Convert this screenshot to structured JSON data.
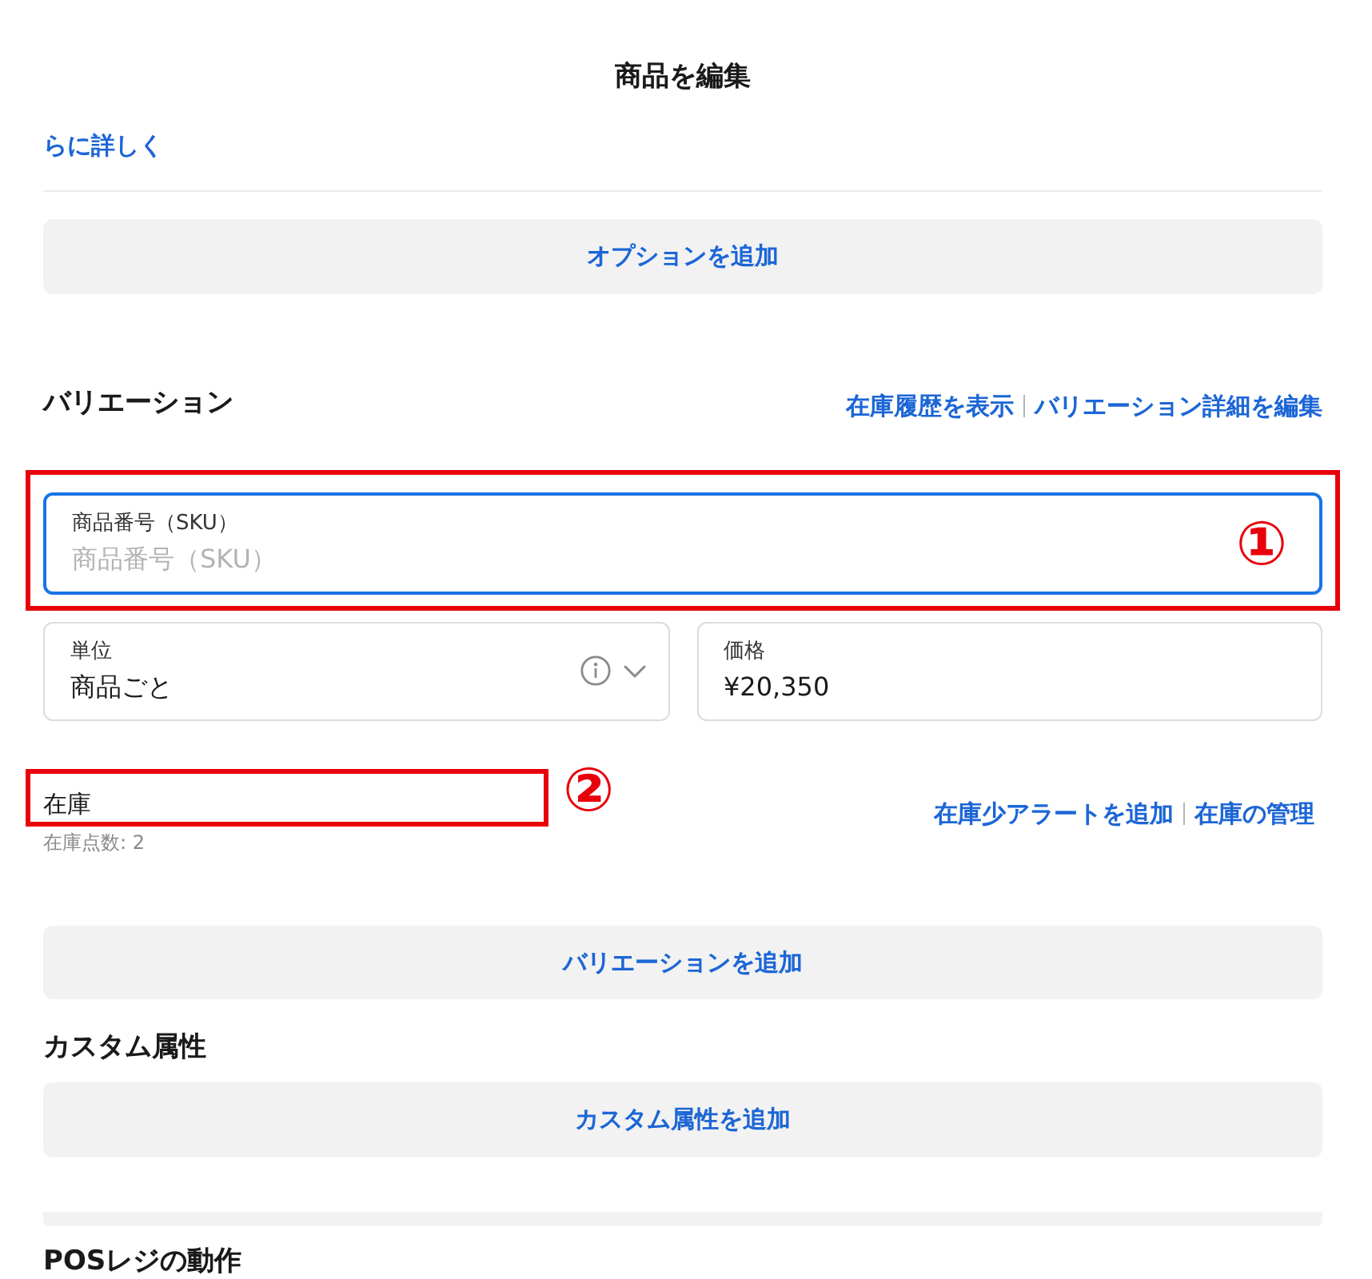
{
  "window": {
    "title": "商品を編集"
  },
  "more_link": {
    "label": "らに詳しく"
  },
  "add_option_button": {
    "label": "オプションを追加"
  },
  "variations": {
    "heading": "バリエーション",
    "links": [
      "在庫履歴を表示",
      "バリエーション詳細を編集"
    ],
    "sku_field": {
      "label": "商品番号（SKU）",
      "placeholder": "商品番号（SKU）",
      "focused": true
    },
    "unit_field": {
      "label": "単位",
      "value": "商品ごと"
    },
    "price_field": {
      "label": "価格",
      "value": "¥20,350"
    },
    "stock": {
      "label": "在庫",
      "count": "在庫点数: 2",
      "links": [
        "在庫少アラートを追加",
        "在庫の管理"
      ]
    },
    "add_button": {
      "label": "バリエーションを追加"
    }
  },
  "custom_attributes": {
    "heading": "カスタム属性",
    "add_button": {
      "label": "カスタム属性を追加"
    }
  },
  "next_section": {
    "heading": "POSレジの動作"
  },
  "annotations": [
    {
      "label": "①"
    },
    {
      "label": "②"
    }
  ]
}
